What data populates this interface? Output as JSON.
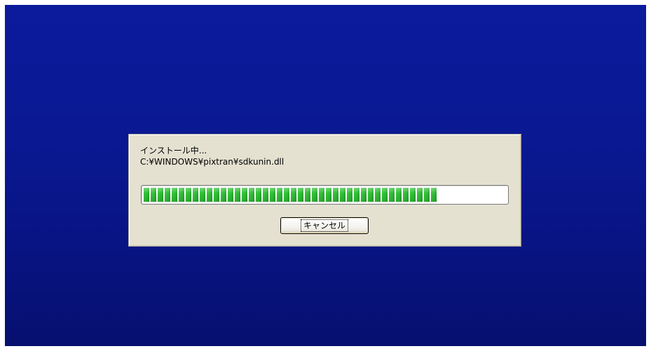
{
  "dialog": {
    "status_title": "インストール中...",
    "status_path": "C:¥WINDOWS¥pixtran¥sdkunin.dll",
    "progress_percent": 81,
    "cancel_label": "キャンセル"
  },
  "colors": {
    "background_top": "#0b1b9c",
    "background_bottom": "#06106f",
    "dialog_face": "#ece9d8",
    "progress_green": "#2fbb34"
  }
}
